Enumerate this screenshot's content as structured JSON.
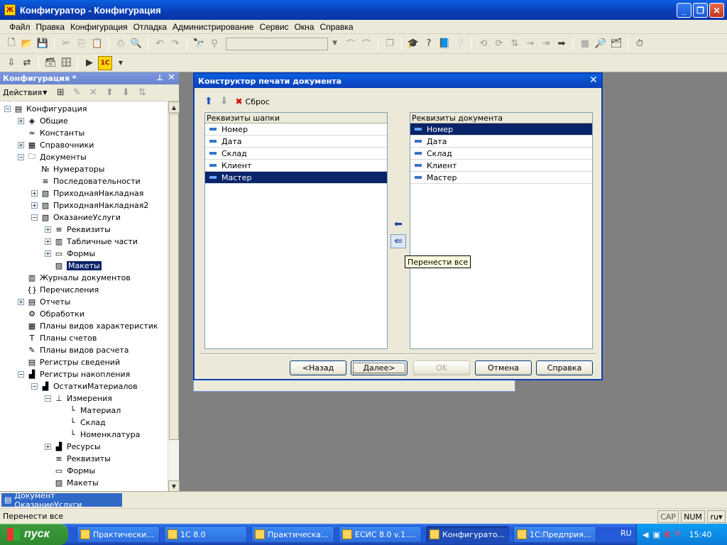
{
  "window": {
    "title": "Конфигуратор - Конфигурация"
  },
  "menu": [
    "Файл",
    "Правка",
    "Конфигурация",
    "Отладка",
    "Администрирование",
    "Сервис",
    "Окна",
    "Справка"
  ],
  "left_panel": {
    "title": "Конфигурация *",
    "actions_label": "Действия",
    "tree": [
      {
        "label": "Конфигурация",
        "level": 0,
        "expander": "minus",
        "icon": "config-icon"
      },
      {
        "label": "Общие",
        "level": 1,
        "expander": "plus",
        "icon": "common-icon"
      },
      {
        "label": "Константы",
        "level": 1,
        "expander": "none",
        "icon": "constants-icon"
      },
      {
        "label": "Справочники",
        "level": 1,
        "expander": "plus",
        "icon": "catalogs-icon"
      },
      {
        "label": "Документы",
        "level": 1,
        "expander": "minus",
        "icon": "documents-icon"
      },
      {
        "label": "Нумераторы",
        "level": 2,
        "expander": "none",
        "icon": "numerators-icon"
      },
      {
        "label": "Последовательности",
        "level": 2,
        "expander": "none",
        "icon": "sequences-icon"
      },
      {
        "label": "ПриходнаяНакладная",
        "level": 2,
        "expander": "plus",
        "icon": "document-icon"
      },
      {
        "label": "ПриходнаяНакладная2",
        "level": 2,
        "expander": "plus",
        "icon": "document-icon"
      },
      {
        "label": "ОказаниеУслуги",
        "level": 2,
        "expander": "minus",
        "icon": "document-icon"
      },
      {
        "label": "Реквизиты",
        "level": 3,
        "expander": "plus",
        "icon": "attributes-icon"
      },
      {
        "label": "Табличные части",
        "level": 3,
        "expander": "plus",
        "icon": "table-parts-icon"
      },
      {
        "label": "Формы",
        "level": 3,
        "expander": "plus",
        "icon": "forms-icon"
      },
      {
        "label": "Макеты",
        "level": 3,
        "expander": "none",
        "icon": "templates-icon",
        "selected": true
      },
      {
        "label": "Журналы документов",
        "level": 1,
        "expander": "none",
        "icon": "journals-icon"
      },
      {
        "label": "Перечисления",
        "level": 1,
        "expander": "none",
        "icon": "enums-icon"
      },
      {
        "label": "Отчеты",
        "level": 1,
        "expander": "plus",
        "icon": "reports-icon"
      },
      {
        "label": "Обработки",
        "level": 1,
        "expander": "none",
        "icon": "processing-icon"
      },
      {
        "label": "Планы видов характеристик",
        "level": 1,
        "expander": "none",
        "icon": "chart-characteristics-icon"
      },
      {
        "label": "Планы счетов",
        "level": 1,
        "expander": "none",
        "icon": "chart-accounts-icon"
      },
      {
        "label": "Планы видов расчета",
        "level": 1,
        "expander": "none",
        "icon": "chart-calc-icon"
      },
      {
        "label": "Регистры сведений",
        "level": 1,
        "expander": "none",
        "icon": "info-registers-icon"
      },
      {
        "label": "Регистры накопления",
        "level": 1,
        "expander": "minus",
        "icon": "accum-registers-icon"
      },
      {
        "label": "ОстаткиМатериалов",
        "level": 2,
        "expander": "minus",
        "icon": "register-icon"
      },
      {
        "label": "Измерения",
        "level": 3,
        "expander": "minus",
        "icon": "dimensions-icon"
      },
      {
        "label": "Материал",
        "level": 4,
        "expander": "none",
        "icon": "dimension-icon"
      },
      {
        "label": "Склад",
        "level": 4,
        "expander": "none",
        "icon": "dimension-icon"
      },
      {
        "label": "Номенклатура",
        "level": 4,
        "expander": "none",
        "icon": "dimension-icon"
      },
      {
        "label": "Ресурсы",
        "level": 3,
        "expander": "plus",
        "icon": "resources-icon"
      },
      {
        "label": "Реквизиты",
        "level": 3,
        "expander": "none",
        "icon": "attributes-icon"
      },
      {
        "label": "Формы",
        "level": 3,
        "expander": "none",
        "icon": "forms-icon"
      },
      {
        "label": "Макеты",
        "level": 3,
        "expander": "none",
        "icon": "templates-icon"
      }
    ]
  },
  "dialog": {
    "title": "Конструктор печати документа",
    "reset_label": "Сброс",
    "header_list": {
      "title": "Реквизиты шапки",
      "items": [
        "Номер",
        "Дата",
        "Склад",
        "Клиент",
        "Мастер"
      ],
      "selected_index": 4
    },
    "document_list": {
      "title": "Реквизиты документа",
      "items": [
        "Номер",
        "Дата",
        "Склад",
        "Клиент",
        "Мастер"
      ],
      "selected_index": 0
    },
    "tooltip": "Перенести все",
    "buttons": {
      "back": "<Назад",
      "next": "Далее>",
      "ok": "OK",
      "cancel": "Отмена",
      "help": "Справка"
    }
  },
  "document_tab": "Документ ОказаниеУслуги",
  "status": {
    "text": "Перенести все",
    "cap": "CAP",
    "num": "NUM",
    "lang": "ru"
  },
  "taskbar": {
    "start_label": "пуск",
    "tasks": [
      "Практически...",
      "1С 8.0",
      "Практическа...",
      "ЕСИС 8.0 v.1....",
      "Конфигурато...",
      "1С:Предприя..."
    ],
    "active_task_index": 4,
    "lang": "RU",
    "clock": "15:40"
  },
  "colors": {
    "selection": "#0a246a",
    "titlebar": "#0a3fb8",
    "face": "#ece9d8"
  }
}
